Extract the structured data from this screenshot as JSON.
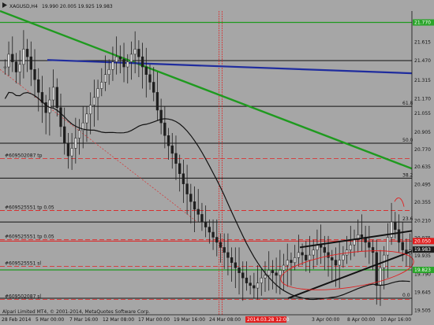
{
  "header": {
    "symbol": "XAGUSD,H4",
    "ohlc": "19.990 20.005 19.925 19.983"
  },
  "footer": {
    "copyright": "Alpari Limited MT4, © 2001-2014, MetaQuotes Software Corp."
  },
  "crosshair_date": "2014.03.28 12:00",
  "colors": {
    "background": "#a6a6a6",
    "candle": "#1e1e1e",
    "green": "#1f9a1f",
    "blue": "#1f2c9e",
    "red": "#e02020",
    "black": "#121212",
    "price_box_green": "#2aa52a",
    "price_box_red": "#e11d1d",
    "price_box_dark": "#1a1a1a"
  },
  "chart_data": {
    "type": "candlestick",
    "ylim": [
      19.47,
      21.86
    ],
    "x_ticks": [
      "28 Feb 2014",
      "5 Mar 00:00",
      "7 Mar 16:00",
      "12 Mar 08:00",
      "17 Mar 00:00",
      "19 Mar 16:00",
      "24 Mar 08:00",
      "2014.03.28 12:00",
      "3 Apr 00:00",
      "8 Apr 00:00",
      "10 Apr 16:00"
    ],
    "y_ticks": [
      "21.770",
      "21.615",
      "21.470",
      "21.315",
      "21.170",
      "21.055",
      "20.905",
      "20.770",
      "20.635",
      "20.495",
      "20.355",
      "20.210",
      "20.075",
      "19.935",
      "19.790",
      "19.645",
      "19.505"
    ],
    "price_labels": [
      {
        "text": "21.770",
        "price": 21.77,
        "style": "green"
      },
      {
        "text": "20.050",
        "price": 20.05,
        "style": "red"
      },
      {
        "text": "19.983",
        "price": 19.983,
        "style": "dark"
      },
      {
        "text": "19.823",
        "price": 19.823,
        "style": "green"
      }
    ],
    "fib_labels": [
      {
        "text": "61.8",
        "price": 21.11
      },
      {
        "text": "50.0",
        "price": 20.82
      },
      {
        "text": "38.2",
        "price": 20.545
      },
      {
        "text": "23.6",
        "price": 20.2
      },
      {
        "text": "0.0",
        "price": 19.6
      }
    ],
    "order_labels": [
      {
        "text": "#609502087 tp",
        "price": 20.7
      },
      {
        "text": "#609525551 tp 0.05",
        "price": 20.29
      },
      {
        "text": "#609525551 tp 0.05",
        "price": 20.06
      },
      {
        "text": "#609525551 sl",
        "price": 19.85
      },
      {
        "text": "#609502087 sl",
        "price": 19.59
      }
    ],
    "series": [
      {
        "name": "price",
        "values": [
          21.42,
          21.52,
          21.46,
          21.38,
          21.44,
          21.56,
          21.5,
          21.4,
          21.32,
          21.22,
          21.14,
          21.06,
          21.16,
          21.26,
          21.1,
          20.95,
          20.82,
          20.72,
          20.78,
          20.86,
          20.92,
          20.98,
          21.05,
          21.12,
          21.18,
          21.25,
          21.3,
          21.36,
          21.4,
          21.46,
          21.5,
          21.48,
          21.42,
          21.46,
          21.52,
          21.56,
          21.5,
          21.42,
          21.36,
          21.3,
          21.22,
          21.08,
          20.98,
          20.88,
          20.8,
          20.74,
          20.66,
          20.58,
          20.5,
          20.42,
          20.36,
          20.3,
          20.26,
          20.2,
          20.16,
          20.12,
          20.08,
          20.04,
          20.0,
          19.96,
          19.92,
          19.88,
          19.84,
          19.8,
          19.76,
          19.72,
          19.7,
          19.68,
          19.72,
          19.76,
          19.78,
          19.82,
          19.8,
          19.78,
          19.82,
          19.86,
          19.9,
          19.88,
          19.92,
          19.96,
          19.94,
          19.9,
          19.94,
          19.98,
          20.02,
          20.0,
          19.96,
          19.92,
          19.9,
          19.86,
          19.9,
          19.94,
          19.98,
          20.02,
          20.06,
          20.1,
          20.08,
          20.04,
          20.0,
          19.96,
          19.7,
          19.84,
          19.94,
          20.08,
          20.2,
          20.14,
          20.04,
          19.98,
          19.95,
          19.98
        ]
      }
    ]
  }
}
